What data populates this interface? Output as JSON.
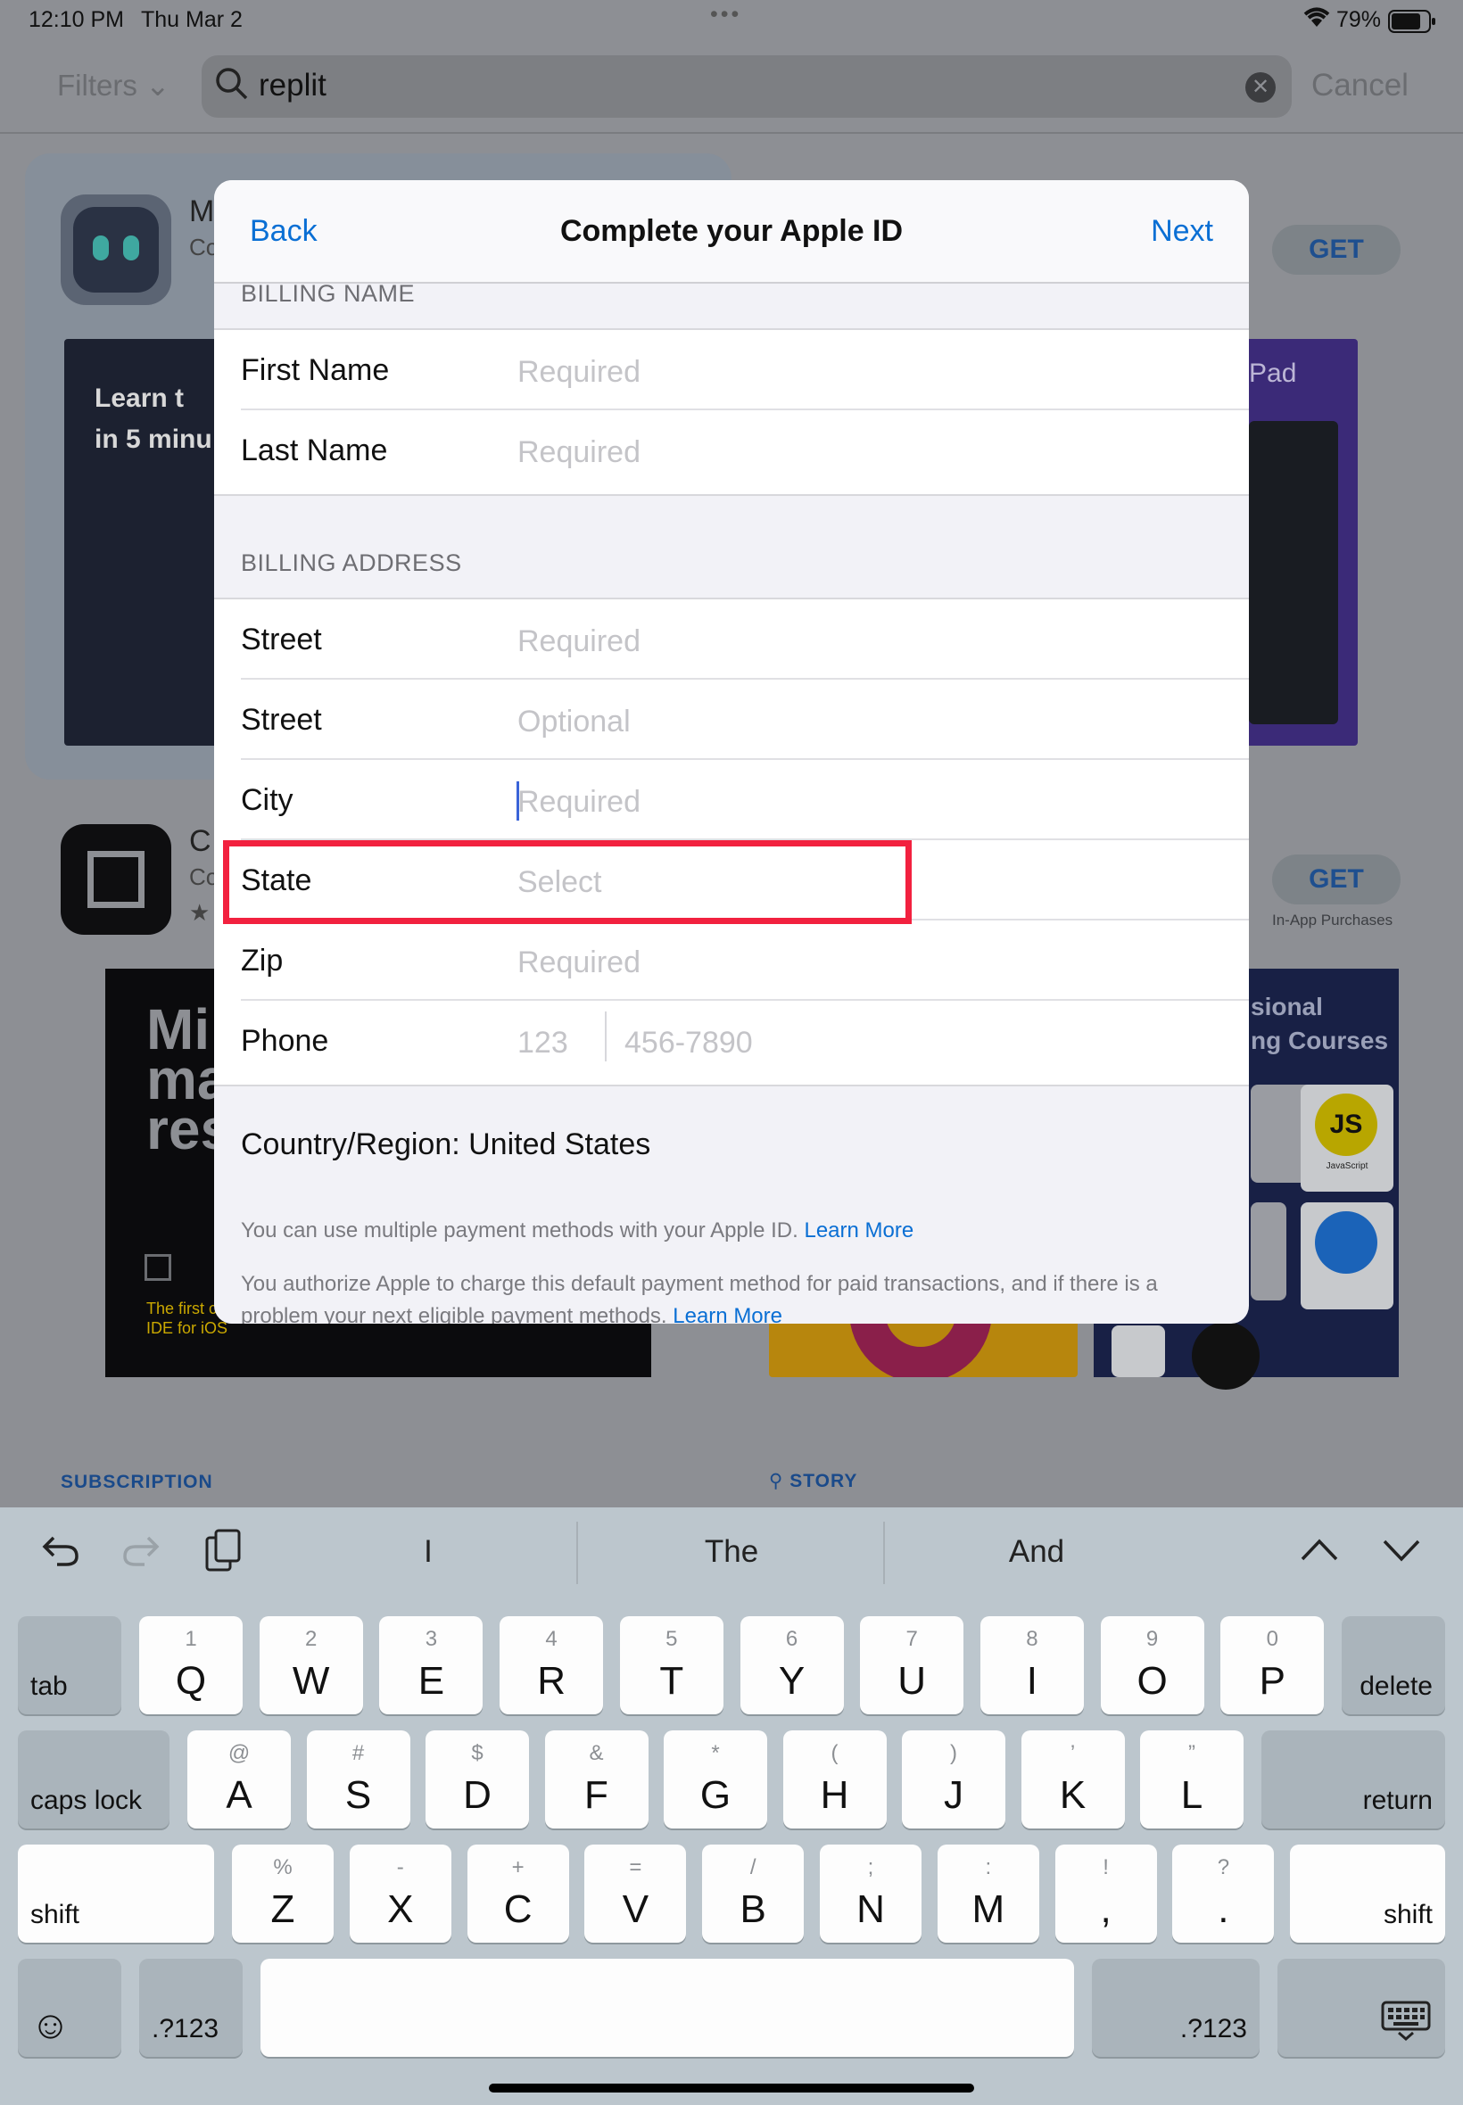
{
  "status": {
    "time": "12:10 PM",
    "date": "Thu Mar 2",
    "battery": "79%"
  },
  "search": {
    "filters": "Filters",
    "query": "replit",
    "cancel": "Cancel"
  },
  "background": {
    "app1_initial": "M",
    "app1_sub": "Co",
    "shot1_text": "Learn t\nin 5 minu",
    "shot2_text": "Pad",
    "get": "GET",
    "app2_initial": "C",
    "app2_sub": "Co",
    "in_app": "In-App Purchases",
    "shot3_big": "Mi\nma\nres",
    "shot3_small": "The first c\nIDE for iOS",
    "shot5_text": "sional\nng Courses",
    "js_label": "JS",
    "js_sub": "JavaScript",
    "subscription": "SUBSCRIPTION",
    "story": "STORY"
  },
  "modal": {
    "back": "Back",
    "title": "Complete your Apple ID",
    "next": "Next",
    "billing_name_header": "BILLING NAME",
    "billing_address_header": "BILLING ADDRESS",
    "name_rows": [
      {
        "label": "First Name",
        "placeholder": "Required"
      },
      {
        "label": "Last Name",
        "placeholder": "Required"
      }
    ],
    "address_rows": [
      {
        "label": "Street",
        "placeholder": "Required"
      },
      {
        "label": "Street",
        "placeholder": "Optional"
      },
      {
        "label": "City",
        "placeholder": "Required"
      },
      {
        "label": "State",
        "placeholder": "Select"
      },
      {
        "label": "Zip",
        "placeholder": "Required"
      },
      {
        "label": "Phone",
        "placeholder_area": "123",
        "placeholder_number": "456-7890"
      }
    ],
    "country": "Country/Region: United States",
    "footer1": "You can use multiple payment methods with your Apple ID.",
    "footer1_link": "Learn More",
    "footer2": "You authorize Apple to charge this default payment method for paid transactions, and if there is a",
    "footer3": "problem your next eligible payment methods.",
    "footer3_link": "Learn More"
  },
  "keyboard": {
    "suggestions": [
      "I",
      "The",
      "And"
    ],
    "row1": [
      {
        "alt": "1",
        "key": "Q"
      },
      {
        "alt": "2",
        "key": "W"
      },
      {
        "alt": "3",
        "key": "E"
      },
      {
        "alt": "4",
        "key": "R"
      },
      {
        "alt": "5",
        "key": "T"
      },
      {
        "alt": "6",
        "key": "Y"
      },
      {
        "alt": "7",
        "key": "U"
      },
      {
        "alt": "8",
        "key": "I"
      },
      {
        "alt": "9",
        "key": "O"
      },
      {
        "alt": "0",
        "key": "P"
      }
    ],
    "row2": [
      {
        "alt": "@",
        "key": "A"
      },
      {
        "alt": "#",
        "key": "S"
      },
      {
        "alt": "$",
        "key": "D"
      },
      {
        "alt": "&",
        "key": "F"
      },
      {
        "alt": "*",
        "key": "G"
      },
      {
        "alt": "(",
        "key": "H"
      },
      {
        "alt": ")",
        "key": "J"
      },
      {
        "alt": "’",
        "key": "K"
      },
      {
        "alt": "”",
        "key": "L"
      }
    ],
    "row3": [
      {
        "alt": "%",
        "key": "Z"
      },
      {
        "alt": "-",
        "key": "X"
      },
      {
        "alt": "+",
        "key": "C"
      },
      {
        "alt": "=",
        "key": "V"
      },
      {
        "alt": "/",
        "key": "B"
      },
      {
        "alt": ";",
        "key": "N"
      },
      {
        "alt": ":",
        "key": "M"
      },
      {
        "alt": "!",
        "key": ","
      },
      {
        "alt": "?",
        "key": "."
      }
    ],
    "tab": "tab",
    "delete": "delete",
    "caps": "caps lock",
    "return": "return",
    "shift": "shift",
    "numbers": ".?123"
  },
  "colors": {
    "accent": "#0a6fd4",
    "highlight": "#f2213f"
  }
}
